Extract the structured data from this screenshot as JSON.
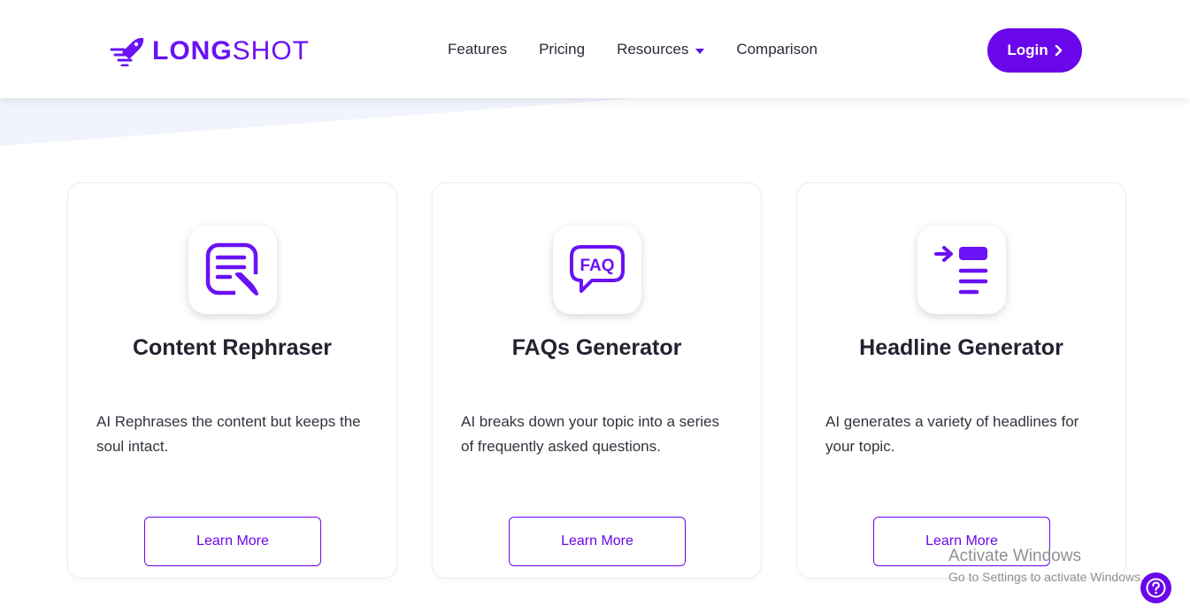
{
  "brand": {
    "logo_bold": "LONG",
    "logo_light": "SHOT",
    "color": "#6a11f5"
  },
  "nav": {
    "items": [
      {
        "label": "Features"
      },
      {
        "label": "Pricing"
      },
      {
        "label": "Resources",
        "has_dropdown": true
      },
      {
        "label": "Comparison"
      }
    ],
    "login_label": "Login"
  },
  "cards": [
    {
      "icon": "document-edit-icon",
      "title": "Content Rephraser",
      "description": "AI Rephrases the content but keeps the soul intact.",
      "button": "Learn More"
    },
    {
      "icon": "faq-bubble-icon",
      "title": "FAQs Generator",
      "description": "AI breaks down your topic into a series of frequently asked questions.",
      "button": "Learn More"
    },
    {
      "icon": "headline-list-icon",
      "title": "Headline Generator",
      "description": "AI generates a variety of headlines for your topic.",
      "button": "Learn More"
    }
  ],
  "watermark": {
    "line1": "Activate Windows",
    "line2": "Go to Settings to activate Windows."
  },
  "accent_color": "#6a07ea"
}
